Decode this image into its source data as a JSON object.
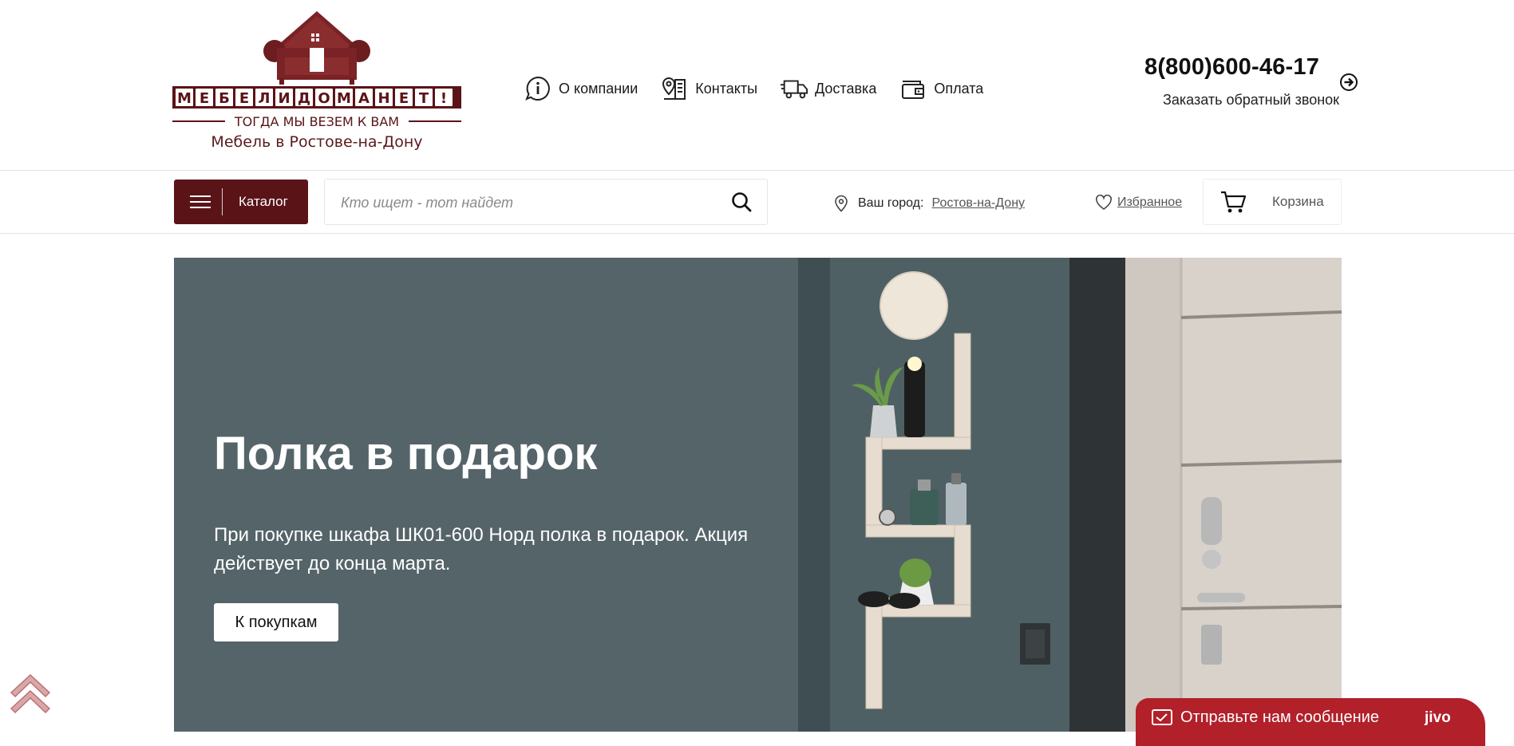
{
  "header": {
    "logo": {
      "brand": "МЕБЕЛИДОМАНЕТ",
      "slogan": "ТОГДА МЫ ВЕЗЕМ К ВАМ",
      "tagline": "Мебель в Ростове-на-Дону"
    },
    "nav": [
      {
        "label": "О компании",
        "icon": "info-icon"
      },
      {
        "label": "Контакты",
        "icon": "map-pin-building-icon"
      },
      {
        "label": "Доставка",
        "icon": "truck-icon"
      },
      {
        "label": "Оплата",
        "icon": "wallet-icon"
      }
    ],
    "phone": "8(800)600-46-17",
    "callback_label": "Заказать обратный звонок"
  },
  "toolbar": {
    "catalog_label": "Каталог",
    "search_placeholder": "Кто ищет - тот найдет",
    "city_label": "Ваш город:",
    "city_value": "Ростов-на-Дону",
    "favorites_label": "Избранное",
    "cart_label": "Корзина"
  },
  "banner": {
    "title": "Полка в подарок",
    "text": "При покупке шкафа ШК01-600 Норд полка в подарок. Акция действует до конца марта.",
    "button_label": "К покупкам"
  },
  "chat": {
    "label": "Отправьте нам сообщение",
    "brand": "jivo"
  },
  "colors": {
    "brand": "#5a1418",
    "banner_bg": "#556469",
    "chat_bg": "#b2202a"
  }
}
